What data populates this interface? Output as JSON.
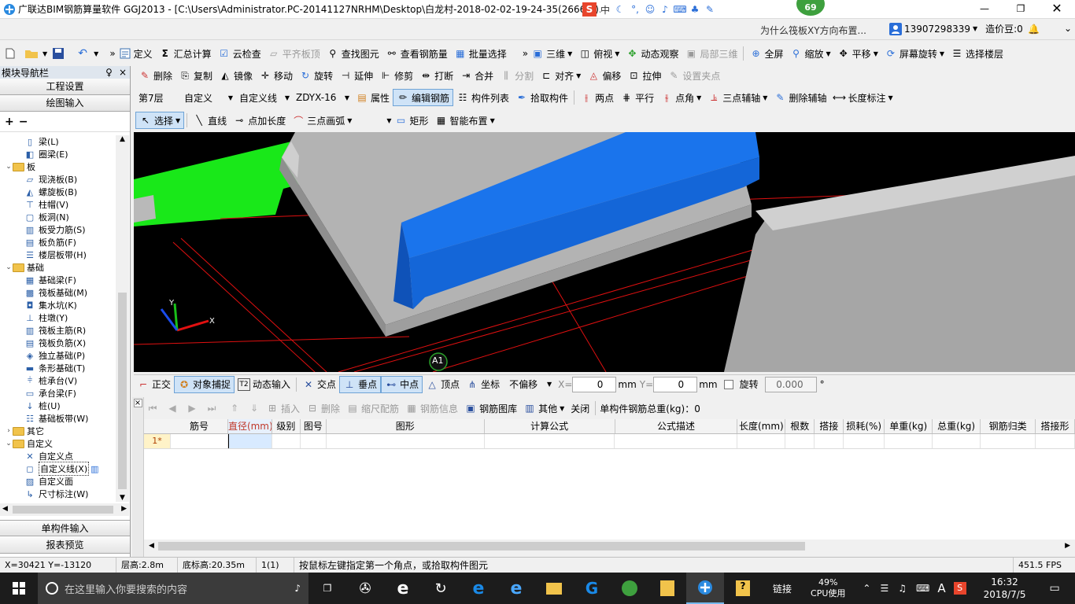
{
  "titlebar": {
    "title": "广联达BIM钢筋算量软件 GGJ2013 - [C:\\Users\\Administrator.PC-20141127NRHM\\Desktop\\白龙村-2018-02-02-19-24-35(2666版).GGJ12]",
    "badge_count": "69"
  },
  "menubar": {
    "question": "为什么筏板XY方向布置...",
    "phone": "13907298339",
    "coins": "造价豆:0"
  },
  "toolbar1": {
    "define": "定义",
    "sum": "汇总计算",
    "cloud_check": "云检查",
    "flat_top": "平齐板顶",
    "find_elem": "查找图元",
    "view_rebar": "查看钢筋量",
    "batch_select": "批量选择",
    "three_d": "三维",
    "top_view": "俯视",
    "dynamic": "动态观察",
    "local_3d": "局部三维",
    "fullscreen": "全屏",
    "zoom": "缩放",
    "pan": "平移",
    "rotate_screen": "屏幕旋转",
    "select_floor": "选择楼层"
  },
  "toolbar2": {
    "delete": "删除",
    "copy": "复制",
    "mirror": "镜像",
    "move": "移动",
    "rotate": "旋转",
    "extend": "延伸",
    "trim": "修剪",
    "break": "打断",
    "merge": "合并",
    "split": "分割",
    "align": "对齐",
    "offset": "偏移",
    "stretch": "拉伸",
    "grip": "设置夹点"
  },
  "toolbar3": {
    "floor": "第7层",
    "category": "自定义",
    "type": "自定义线",
    "name": "ZDYX-16",
    "properties": "属性",
    "edit_rebar": "编辑钢筋",
    "elem_list": "构件列表",
    "pick_elem": "拾取构件",
    "two_point": "两点",
    "parallel": "平行",
    "point_angle": "点角",
    "three_axis": "三点辅轴",
    "del_axis": "删除辅轴",
    "length_dim": "长度标注"
  },
  "toolbar4": {
    "select": "选择",
    "line": "直线",
    "point_length": "点加长度",
    "arc": "三点画弧",
    "rect": "矩形",
    "smart": "智能布置"
  },
  "nav": {
    "title": "模块导航栏",
    "pin": "♀",
    "close": "×",
    "project_settings": "工程设置",
    "drawing_input": "绘图输入",
    "single_input": "单构件输入",
    "report_preview": "报表预览",
    "tree": [
      {
        "level": 2,
        "label": "梁(L)",
        "icon": "beam-icon"
      },
      {
        "level": 2,
        "label": "圈梁(E)",
        "icon": "ring-beam-icon"
      },
      {
        "level": 1,
        "label": "板",
        "icon": "folder-icon",
        "expanded": true
      },
      {
        "level": 2,
        "label": "现浇板(B)",
        "icon": "slab-icon"
      },
      {
        "level": 2,
        "label": "螺旋板(B)",
        "icon": "spiral-slab-icon"
      },
      {
        "level": 2,
        "label": "柱帽(V)",
        "icon": "column-cap-icon"
      },
      {
        "level": 2,
        "label": "板洞(N)",
        "icon": "slab-hole-icon"
      },
      {
        "level": 2,
        "label": "板受力筋(S)",
        "icon": "slab-rebar-icon"
      },
      {
        "level": 2,
        "label": "板负筋(F)",
        "icon": "slab-neg-rebar-icon"
      },
      {
        "level": 2,
        "label": "楼层板带(H)",
        "icon": "floor-strip-icon"
      },
      {
        "level": 1,
        "label": "基础",
        "icon": "folder-icon",
        "expanded": true
      },
      {
        "level": 2,
        "label": "基础梁(F)",
        "icon": "foundation-beam-icon"
      },
      {
        "level": 2,
        "label": "筏板基础(M)",
        "icon": "raft-icon"
      },
      {
        "level": 2,
        "label": "集水坑(K)",
        "icon": "sump-icon"
      },
      {
        "level": 2,
        "label": "柱墩(Y)",
        "icon": "pier-icon"
      },
      {
        "level": 2,
        "label": "筏板主筋(R)",
        "icon": "raft-main-rebar-icon"
      },
      {
        "level": 2,
        "label": "筏板负筋(X)",
        "icon": "raft-neg-rebar-icon"
      },
      {
        "level": 2,
        "label": "独立基础(P)",
        "icon": "isolated-footing-icon"
      },
      {
        "level": 2,
        "label": "条形基础(T)",
        "icon": "strip-footing-icon"
      },
      {
        "level": 2,
        "label": "桩承台(V)",
        "icon": "pile-cap-icon"
      },
      {
        "level": 2,
        "label": "承台梁(F)",
        "icon": "cap-beam-icon"
      },
      {
        "level": 2,
        "label": "桩(U)",
        "icon": "pile-icon"
      },
      {
        "level": 2,
        "label": "基础板带(W)",
        "icon": "foundation-strip-icon"
      },
      {
        "level": 1,
        "label": "其它",
        "icon": "folder-icon",
        "expanded": false
      },
      {
        "level": 1,
        "label": "自定义",
        "icon": "folder-icon",
        "expanded": true
      },
      {
        "level": 2,
        "label": "自定义点",
        "icon": "custom-point-icon"
      },
      {
        "level": 2,
        "label": "自定义线(X)",
        "icon": "custom-line-icon",
        "selected": true
      },
      {
        "level": 2,
        "label": "自定义面",
        "icon": "custom-face-icon"
      },
      {
        "level": 2,
        "label": "尺寸标注(W)",
        "icon": "dimension-icon"
      }
    ]
  },
  "viewport": {
    "axis_label": "A1",
    "gizmo_y": "Y",
    "gizmo_x": "X"
  },
  "snapbar": {
    "ortho": "正交",
    "snap": "对象捕捉",
    "dynamic_input": "动态输入",
    "intersection": "交点",
    "perpendicular": "垂点",
    "midpoint": "中点",
    "vertex": "顶点",
    "coordinate": "坐标",
    "offset_mode": "不偏移",
    "x_label": "X=",
    "x_value": "0",
    "x_unit": "mm",
    "y_label": "Y=",
    "y_value": "0",
    "y_unit": "mm",
    "rotate_label": "旋转",
    "rotate_value": "0.000",
    "degree": "°"
  },
  "gridbar": {
    "insert": "插入",
    "delete": "删除",
    "scale": "缩尺配筋",
    "rebar_info": "钢筋信息",
    "rebar_lib": "钢筋图库",
    "other": "其他",
    "close": "关闭",
    "total": "单构件钢筋总重(kg)：0"
  },
  "grid": {
    "columns": [
      "筋号",
      "直径(mm)",
      "级别",
      "图号",
      "图形",
      "计算公式",
      "公式描述",
      "长度(mm)",
      "根数",
      "搭接",
      "损耗(%)",
      "单重(kg)",
      "总重(kg)",
      "钢筋归类",
      "搭接形"
    ],
    "row_marker": "1*"
  },
  "status": {
    "coords": "X=30421 Y=-13120",
    "floor_height": "层高:2.8m",
    "bottom_elev": "底标高:20.35m",
    "count": "1(1)",
    "hint": "按鼠标左键指定第一个角点，或拾取构件图元",
    "fps": "451.5 FPS"
  },
  "taskbar": {
    "search_placeholder": "在这里输入你要搜索的内容",
    "link": "链接",
    "cpu_percent": "49%",
    "cpu_label": "CPU使用",
    "ime": "A",
    "time": "16:32",
    "date": "2018/7/5"
  },
  "colors": {
    "beam_blue": "#1466d8",
    "slab_gray": "#b3b3b3",
    "green_member": "#19e819",
    "axis_red": "#e01010",
    "viewport_bg": "#000000"
  }
}
